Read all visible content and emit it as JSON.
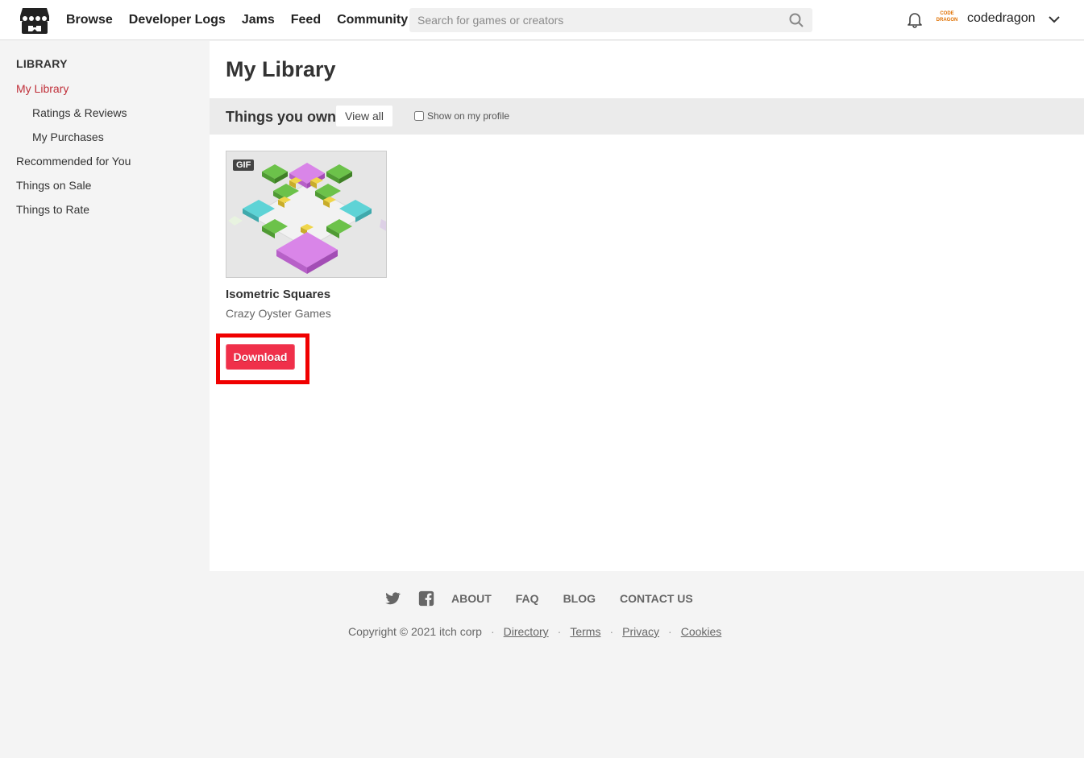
{
  "header": {
    "nav": [
      "Browse",
      "Developer Logs",
      "Jams",
      "Feed",
      "Community"
    ],
    "search_placeholder": "Search for games or creators",
    "avatar_text": "CODE DRAGON",
    "username": "codedragon"
  },
  "sidebar": {
    "title": "LIBRARY",
    "items": [
      {
        "label": "My Library"
      },
      {
        "label": "Ratings & Reviews"
      },
      {
        "label": "My Purchases"
      },
      {
        "label": "Recommended for You"
      },
      {
        "label": "Things on Sale"
      },
      {
        "label": "Things to Rate"
      }
    ]
  },
  "main": {
    "title": "My Library",
    "section_title": "Things you own",
    "view_all": "View all",
    "show_on_profile": "Show on my profile",
    "game": {
      "badge": "GIF",
      "title": "Isometric Squares",
      "author": "Crazy Oyster Games",
      "download": "Download"
    }
  },
  "footer": {
    "links": [
      "ABOUT",
      "FAQ",
      "BLOG",
      "CONTACT US"
    ],
    "copyright": "Copyright © 2021 itch corp",
    "legal": [
      "Directory",
      "Terms",
      "Privacy",
      "Cookies"
    ]
  },
  "colors": {
    "accent": "#fa5c5c",
    "active_link": "#c0303a",
    "download_button": "#f0304a",
    "highlight": "#f00000"
  }
}
